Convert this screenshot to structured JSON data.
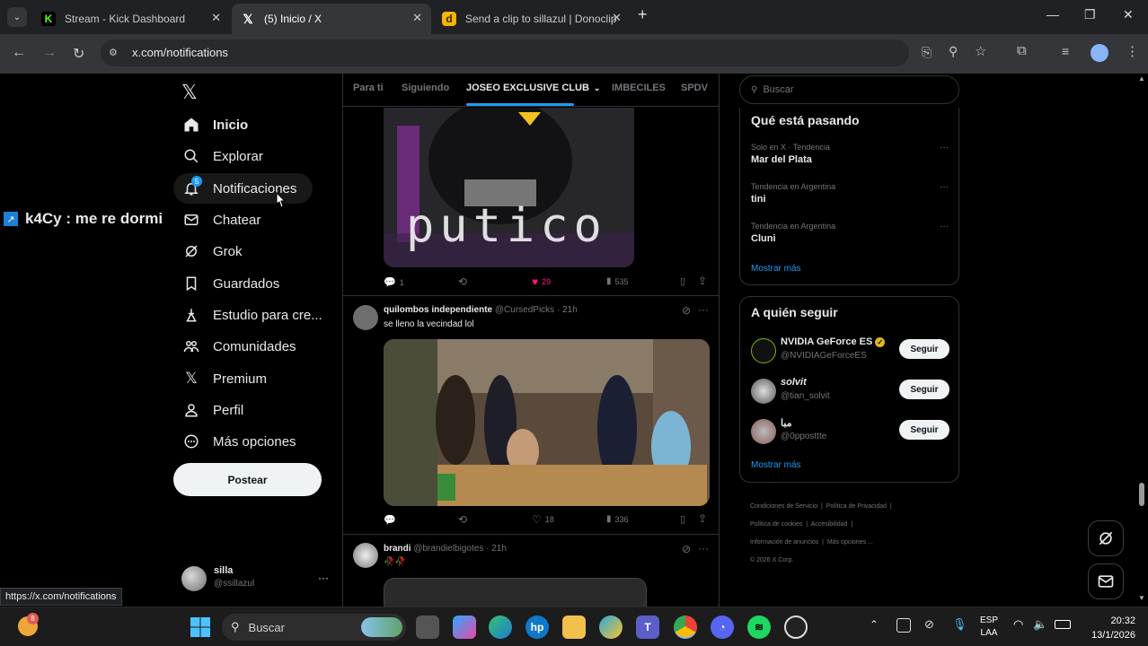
{
  "browser": {
    "tabs": [
      {
        "title": "Stream - Kick Dashboard",
        "icon": "kick-icon",
        "color": "#53fc18"
      },
      {
        "title": "(5) Inicio / X",
        "icon": "x-icon",
        "color": "#ffffff"
      },
      {
        "title": "Send a clip to sillazul | Donoclip",
        "icon": "donoclip-icon",
        "color": "#f5b400"
      }
    ],
    "new_tab": "+",
    "url": "x.com/notifications",
    "status_url": "https://x.com/notifications"
  },
  "overlay": {
    "text": "k4Cy : me re dormi"
  },
  "sidebar": {
    "logo": "x-logo-icon",
    "items": [
      {
        "label": "Inicio",
        "icon": "home-icon"
      },
      {
        "label": "Explorar",
        "icon": "search-icon"
      },
      {
        "label": "Notificaciones",
        "icon": "bell-icon",
        "badge": "5"
      },
      {
        "label": "Chatear",
        "icon": "mail-icon"
      },
      {
        "label": "Grok",
        "icon": "grok-icon"
      },
      {
        "label": "Guardados",
        "icon": "bookmark-icon"
      },
      {
        "label": "Estudio para cre...",
        "icon": "studio-icon"
      },
      {
        "label": "Comunidades",
        "icon": "communities-icon"
      },
      {
        "label": "Premium",
        "icon": "x-premium-icon"
      },
      {
        "label": "Perfil",
        "icon": "profile-icon"
      },
      {
        "label": "Más opciones",
        "icon": "more-icon"
      }
    ],
    "post_button": "Postear",
    "account": {
      "name": "silla",
      "handle": "@ssillazul",
      "more": "···"
    }
  },
  "timeline": {
    "tabs": [
      "Para ti",
      "Siguiendo",
      "JOSEO EXCLUSIVE CLUB",
      "IMBECILES",
      "SPDV"
    ],
    "active_tab": 2,
    "posts": [
      {
        "image_caption": "putico",
        "stats": {
          "replies": "1",
          "likes": "29",
          "views": "535"
        }
      },
      {
        "name": "quilombos independiente",
        "handle": "@CursedPicks",
        "time": "· 21h",
        "text": "se lleno la vecindad lol",
        "stats": {
          "replies": "",
          "likes": "18",
          "views": "336"
        }
      },
      {
        "name": "brandi",
        "handle": "@brandielbigotes",
        "time": "· 21h",
        "text": "🥀🥀"
      }
    ]
  },
  "right": {
    "search_placeholder": "Buscar",
    "trends_title": "Qué está pasando",
    "trends": [
      {
        "category": "Solo en X · Tendencia",
        "name": "Mar del Plata"
      },
      {
        "category": "Tendencia en Argentina",
        "name": "tini"
      },
      {
        "category": "Tendencia en Argentina",
        "name": "Cluni"
      }
    ],
    "show_more": "Mostrar más",
    "follow_title": "A quién seguir",
    "follow": [
      {
        "name": "NVIDIA GeForce ES",
        "handle": "@NVIDIAGeForceES",
        "verified": true
      },
      {
        "name": "solvit",
        "handle": "@tian_solvit"
      },
      {
        "name": "مبا",
        "handle": "@0pposttte"
      }
    ],
    "follow_button": "Seguir",
    "footer": [
      "Condiciones de Servicio",
      "Política de Privacidad",
      "Política de cookies",
      "Accesibilidad",
      "Información de anuncios",
      "Más opciones ...",
      "© 2026 X Corp."
    ]
  },
  "taskbar": {
    "search_label": "Buscar",
    "notif_badge": "8",
    "lang": "ESP",
    "lang2": "LAA",
    "time": "20:32",
    "date": "13/1/2026"
  },
  "colors": {
    "accent": "#1d9bf0",
    "like": "#f91880",
    "bg": "#000000"
  }
}
